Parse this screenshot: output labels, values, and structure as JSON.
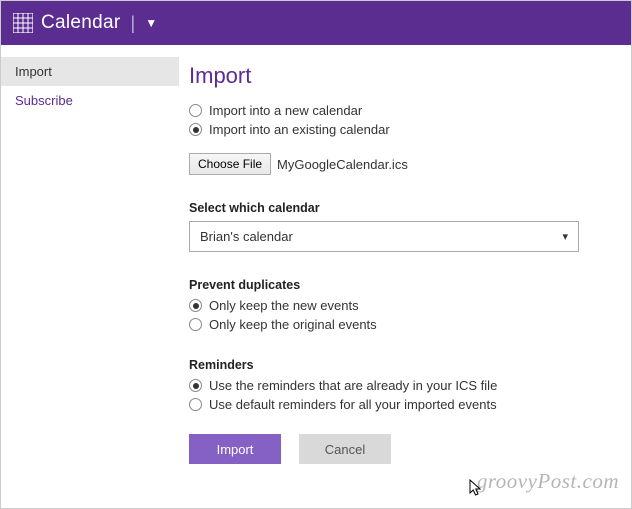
{
  "header": {
    "title": "Calendar"
  },
  "sidebar": {
    "items": [
      {
        "label": "Import",
        "active": true
      },
      {
        "label": "Subscribe",
        "active": false
      }
    ]
  },
  "main": {
    "title": "Import",
    "importTarget": {
      "optionNew": "Import into a new calendar",
      "optionExisting": "Import into an existing calendar",
      "selected": "existing"
    },
    "file": {
      "buttonLabel": "Choose File",
      "fileName": "MyGoogleCalendar.ics"
    },
    "selectCalendar": {
      "label": "Select which calendar",
      "value": "Brian's calendar"
    },
    "preventDuplicates": {
      "label": "Prevent duplicates",
      "optionNew": "Only keep the new events",
      "optionOriginal": "Only keep the original events",
      "selected": "new"
    },
    "reminders": {
      "label": "Reminders",
      "optionIcs": "Use the reminders that are already in your ICS file",
      "optionDefault": "Use default reminders for all your imported events",
      "selected": "ics"
    },
    "buttons": {
      "import": "Import",
      "cancel": "Cancel"
    }
  },
  "watermark": "groovyPost.com"
}
